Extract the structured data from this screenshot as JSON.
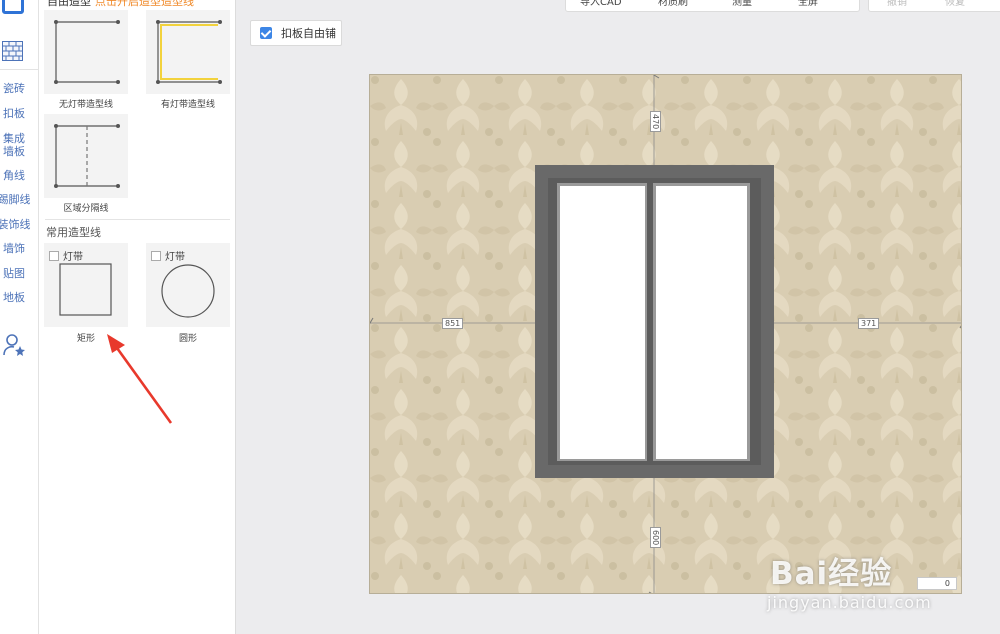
{
  "rail": {
    "categories": [
      "瓷砖",
      "扣板",
      "集成",
      "墙板",
      "角线",
      "踢脚线",
      "装饰线",
      "墙饰",
      "贴图",
      "地板"
    ]
  },
  "catalog": {
    "section1_title": "自由造型",
    "section1_note": "点击开启造型造型线",
    "tiles": [
      {
        "label": "无灯带造型线"
      },
      {
        "label": "有灯带造型线"
      },
      {
        "label": "区域分隔线"
      }
    ],
    "section2_title": "常用造型线",
    "common": [
      {
        "checkbox_label": "灯带",
        "label": "矩形"
      },
      {
        "checkbox_label": "灯带",
        "label": "圆形"
      }
    ]
  },
  "toolbar": {
    "items": [
      "导入CAD",
      "材质刷",
      "测量",
      "全屏"
    ],
    "right_items": [
      "撤销",
      "恢复"
    ]
  },
  "options": {
    "free_tile_label": "扣板自由铺",
    "free_tile_checked": true
  },
  "canvas": {
    "dim_top": "470",
    "dim_left": "851",
    "dim_right": "371",
    "dim_bottom": "600",
    "zoom_value": "0"
  },
  "colors": {
    "accent": "#3d86e6",
    "rail_text": "#4d73b8",
    "wallpaper": "#d9cdb2",
    "window_frame": "#6a6a6a",
    "arrow": "#e8392c",
    "note": "#f08a2a"
  },
  "watermark": {
    "brand": "Bai经验",
    "url": "jingyan.baidu.com"
  }
}
